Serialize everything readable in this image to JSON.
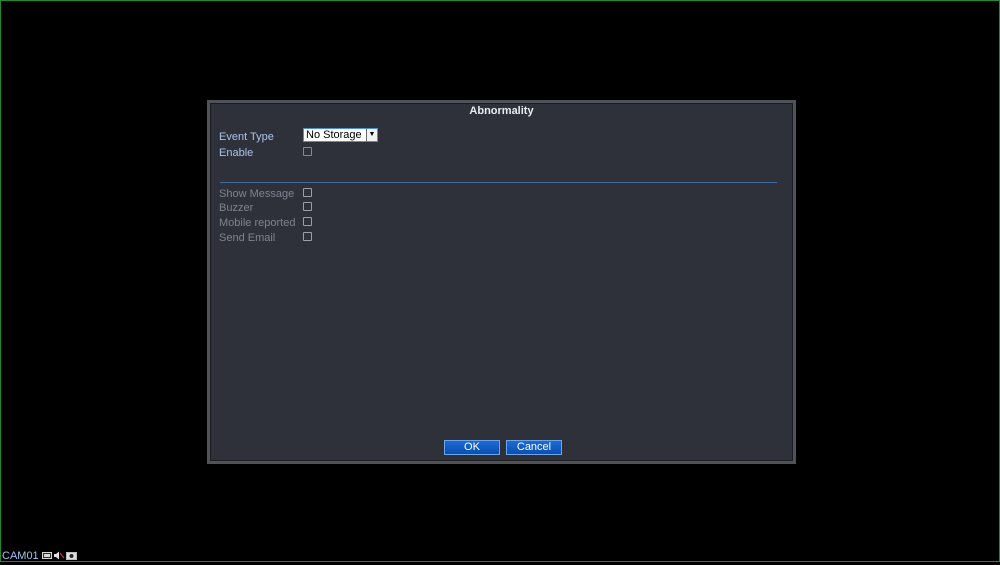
{
  "dialog": {
    "title": "Abnormality",
    "event_type": {
      "label": "Event Type",
      "selected": "No Storage"
    },
    "enable": {
      "label": "Enable",
      "checked": false
    },
    "options": [
      {
        "label": "Show Message",
        "checked": false
      },
      {
        "label": "Buzzer",
        "checked": false
      },
      {
        "label": "Mobile reported",
        "checked": false
      },
      {
        "label": "Send Email",
        "checked": false
      }
    ],
    "ok_label": "OK",
    "cancel_label": "Cancel"
  },
  "statusbar": {
    "camera": "CAM01",
    "icons": [
      "record-icon",
      "audio-mute-icon",
      "camera-icon"
    ]
  },
  "colors": {
    "dialog_bg": "#2f313a",
    "label_active": "#a9c4ea",
    "label_disabled": "#7f8390",
    "button_blue": "#0c4fb0",
    "screen_border": "#1f8a2a"
  }
}
